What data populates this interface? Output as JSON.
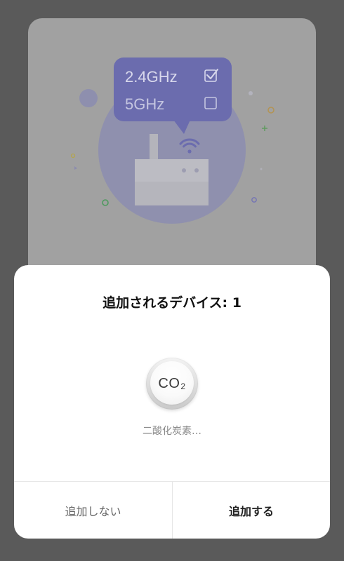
{
  "illustration": {
    "bands": [
      {
        "label": "2.4GHz",
        "checked": true
      },
      {
        "label": "5GHz",
        "checked": false
      }
    ],
    "icons": [
      "router-icon",
      "wifi-icon",
      "checkbox-icon",
      "checkmark-icon"
    ]
  },
  "dialog": {
    "title": "追加されるデバイス: 1",
    "device": {
      "icon": "co2-sensor-icon",
      "icon_text": "CO",
      "icon_subscript": "2",
      "name": "二酸化炭素…"
    },
    "buttons": {
      "cancel": "追加しない",
      "confirm": "追加する"
    }
  },
  "colors": {
    "backdrop": "#5a5a5a",
    "bubble": "#6b6cae",
    "dialog_bg": "#ffffff",
    "title_text": "#111111",
    "secondary_text": "#8a8a8a"
  }
}
